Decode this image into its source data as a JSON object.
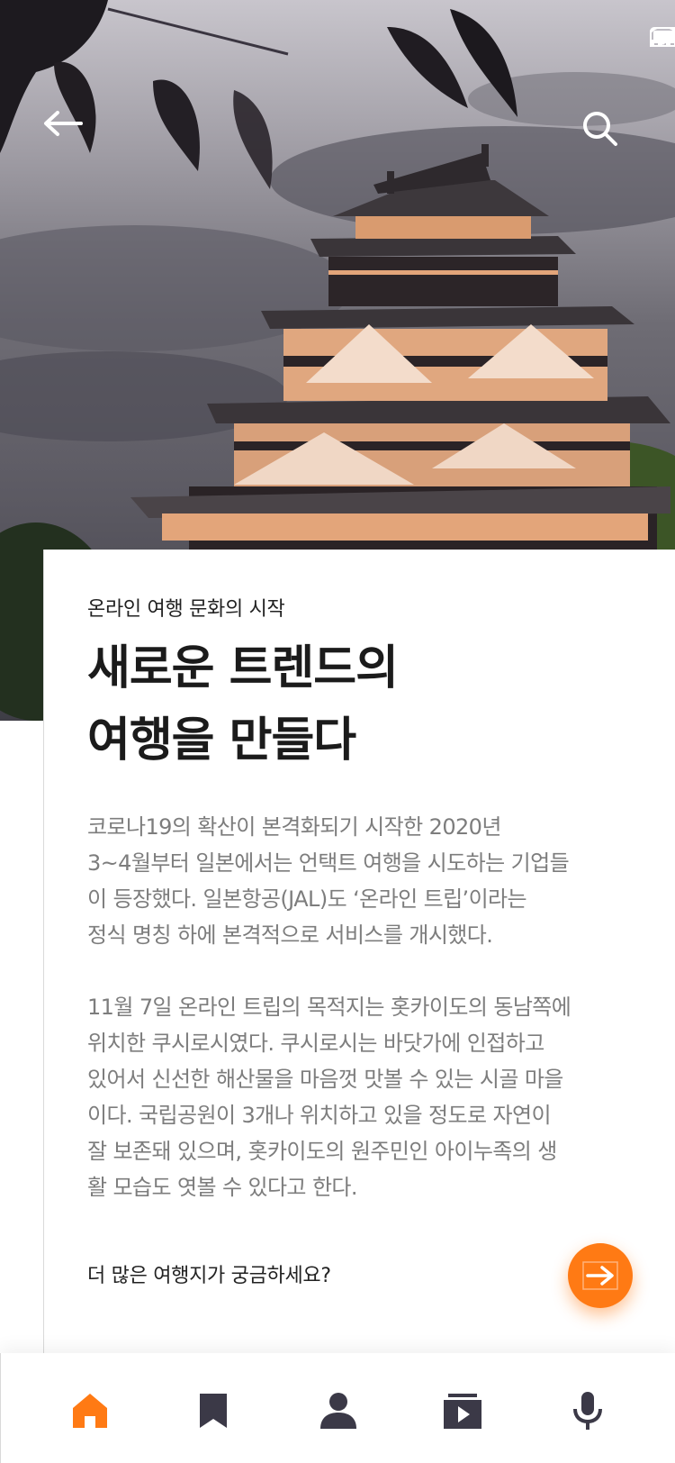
{
  "hero": {
    "image_description_icon": "japanese-castle-photo",
    "status_icons": [
      "signal-icon",
      "wifi-icon",
      "battery-icon"
    ]
  },
  "toolbar": {
    "back_icon": "arrow-left-icon",
    "search_icon": "search-icon"
  },
  "article": {
    "kicker": "온라인 여행 문화의 시작",
    "title_lines": [
      "새로운 트렌드의",
      "여행을 만들다"
    ],
    "paragraph1_lines": [
      "코로나19의 확산이 본격화되기 시작한 2020년",
      "3~4월부터 일본에서는 언택트 여행을 시도하는 기업들",
      "이 등장했다. 일본항공(JAL)도 ‘온라인 트립’이라는",
      "정식 명칭 하에 본격적으로 서비스를 개시했다."
    ],
    "paragraph2_lines": [
      "11월 7일 온라인 트립의 목적지는 홋카이도의 동남쪽에",
      "위치한 쿠시로시였다. 쿠시로시는 바닷가에 인접하고",
      "있어서 신선한 해산물을 마음껏 맛볼 수 있는 시골 마을",
      "이다. 국립공원이 3개나 위치하고 있을 정도로 자연이",
      "잘 보존돼 있으며, 홋카이도의 원주민인 아이누족의 생",
      "활 모습도 엿볼 수 있다고 한다."
    ],
    "more_text": "더 많은 여행지가 궁금하세요?",
    "more_button_icon": "arrow-right-icon"
  },
  "bottom_nav": {
    "items": [
      "home-icon",
      "bookmark-icon",
      "profile-icon",
      "media-icon",
      "microphone-icon"
    ],
    "active": "home-icon"
  },
  "colors": {
    "accent": "#ff7a14",
    "icon_dark": "#3b3947",
    "title": "#1b1b1b",
    "body_text": "#7d7d7d"
  }
}
